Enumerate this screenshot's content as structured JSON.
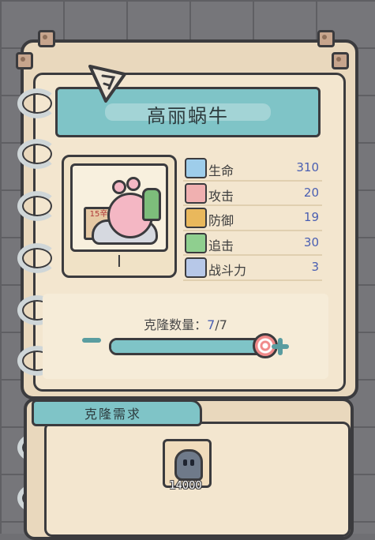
{
  "title": "高丽蜗牛",
  "portrait": {
    "grade": "I",
    "sign_text": "15辛"
  },
  "stats": [
    {
      "icon": "health-icon",
      "label": "生命",
      "value": "310",
      "color": "#9ecdea"
    },
    {
      "icon": "attack-icon",
      "label": "攻击",
      "value": "20",
      "color": "#f0b0b0"
    },
    {
      "icon": "defense-icon",
      "label": "防御",
      "value": "19",
      "color": "#e9b85c"
    },
    {
      "icon": "chase-icon",
      "label": "追击",
      "value": "30",
      "color": "#8fcf8f"
    },
    {
      "icon": "combat-power-icon",
      "label": "战斗力",
      "value": "3",
      "color": "#b7c8e8"
    }
  ],
  "clone": {
    "label": "克隆数量：",
    "current": "7",
    "separator": "/",
    "max": "7",
    "fill_fraction": 1.0
  },
  "requirements": {
    "tab_label": "克隆需求",
    "items": [
      {
        "icon": "ghost-currency-icon",
        "amount": "14000"
      }
    ]
  }
}
